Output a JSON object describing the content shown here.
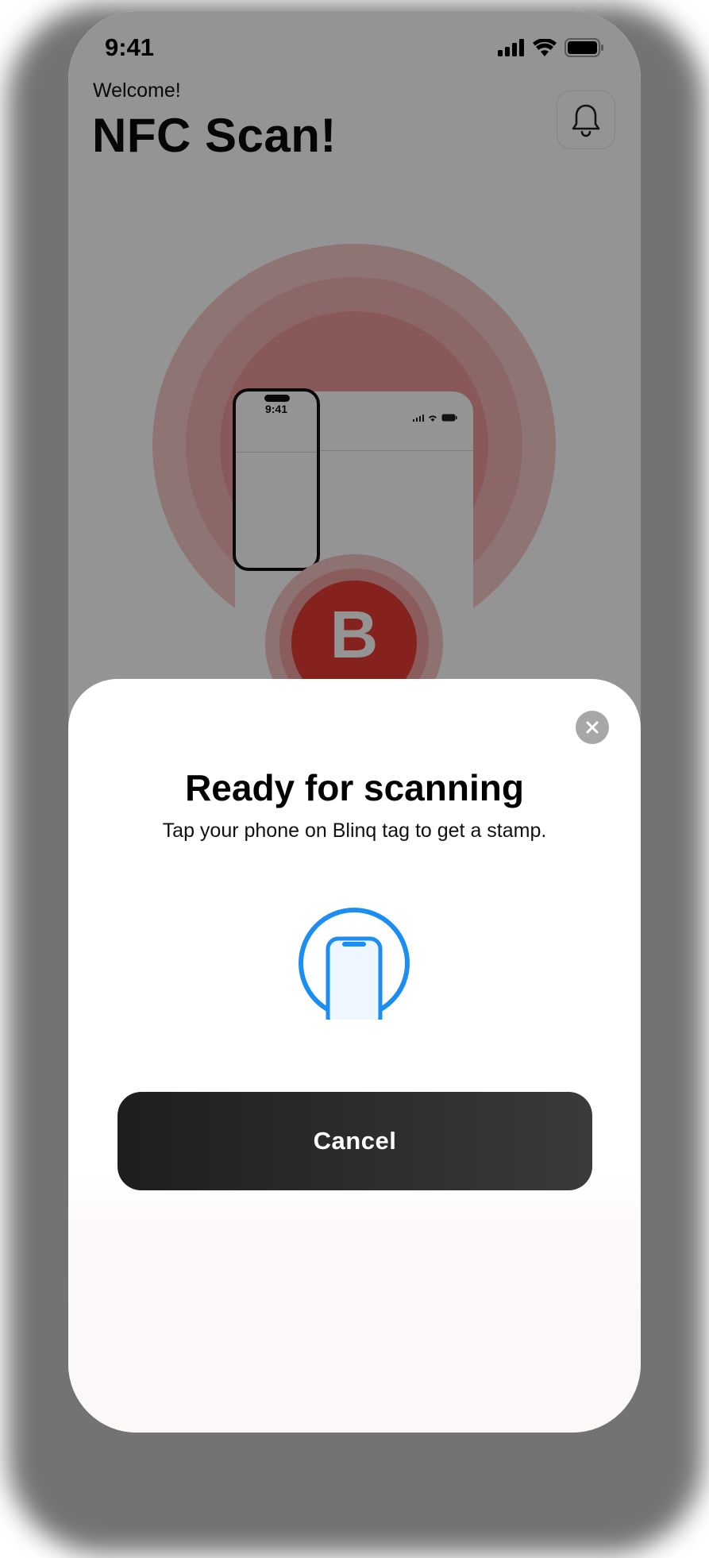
{
  "status_bar": {
    "time": "9:41"
  },
  "header": {
    "welcome": "Welcome!",
    "title": "NFC Scan!"
  },
  "illustration": {
    "mini_phone_time": "9:41",
    "brand_letter": "B"
  },
  "sheet": {
    "title": "Ready for scanning",
    "subtitle": "Tap your phone on Blinq tag to get a stamp.",
    "cancel_label": "Cancel"
  },
  "colors": {
    "accent_blue": "#1a8ef2",
    "brand_red": "#e63b34",
    "button_dark": "#262626"
  },
  "icons": [
    "signal-icon",
    "wifi-icon",
    "battery-icon",
    "bell-icon",
    "close-icon",
    "phone-scan-icon"
  ]
}
